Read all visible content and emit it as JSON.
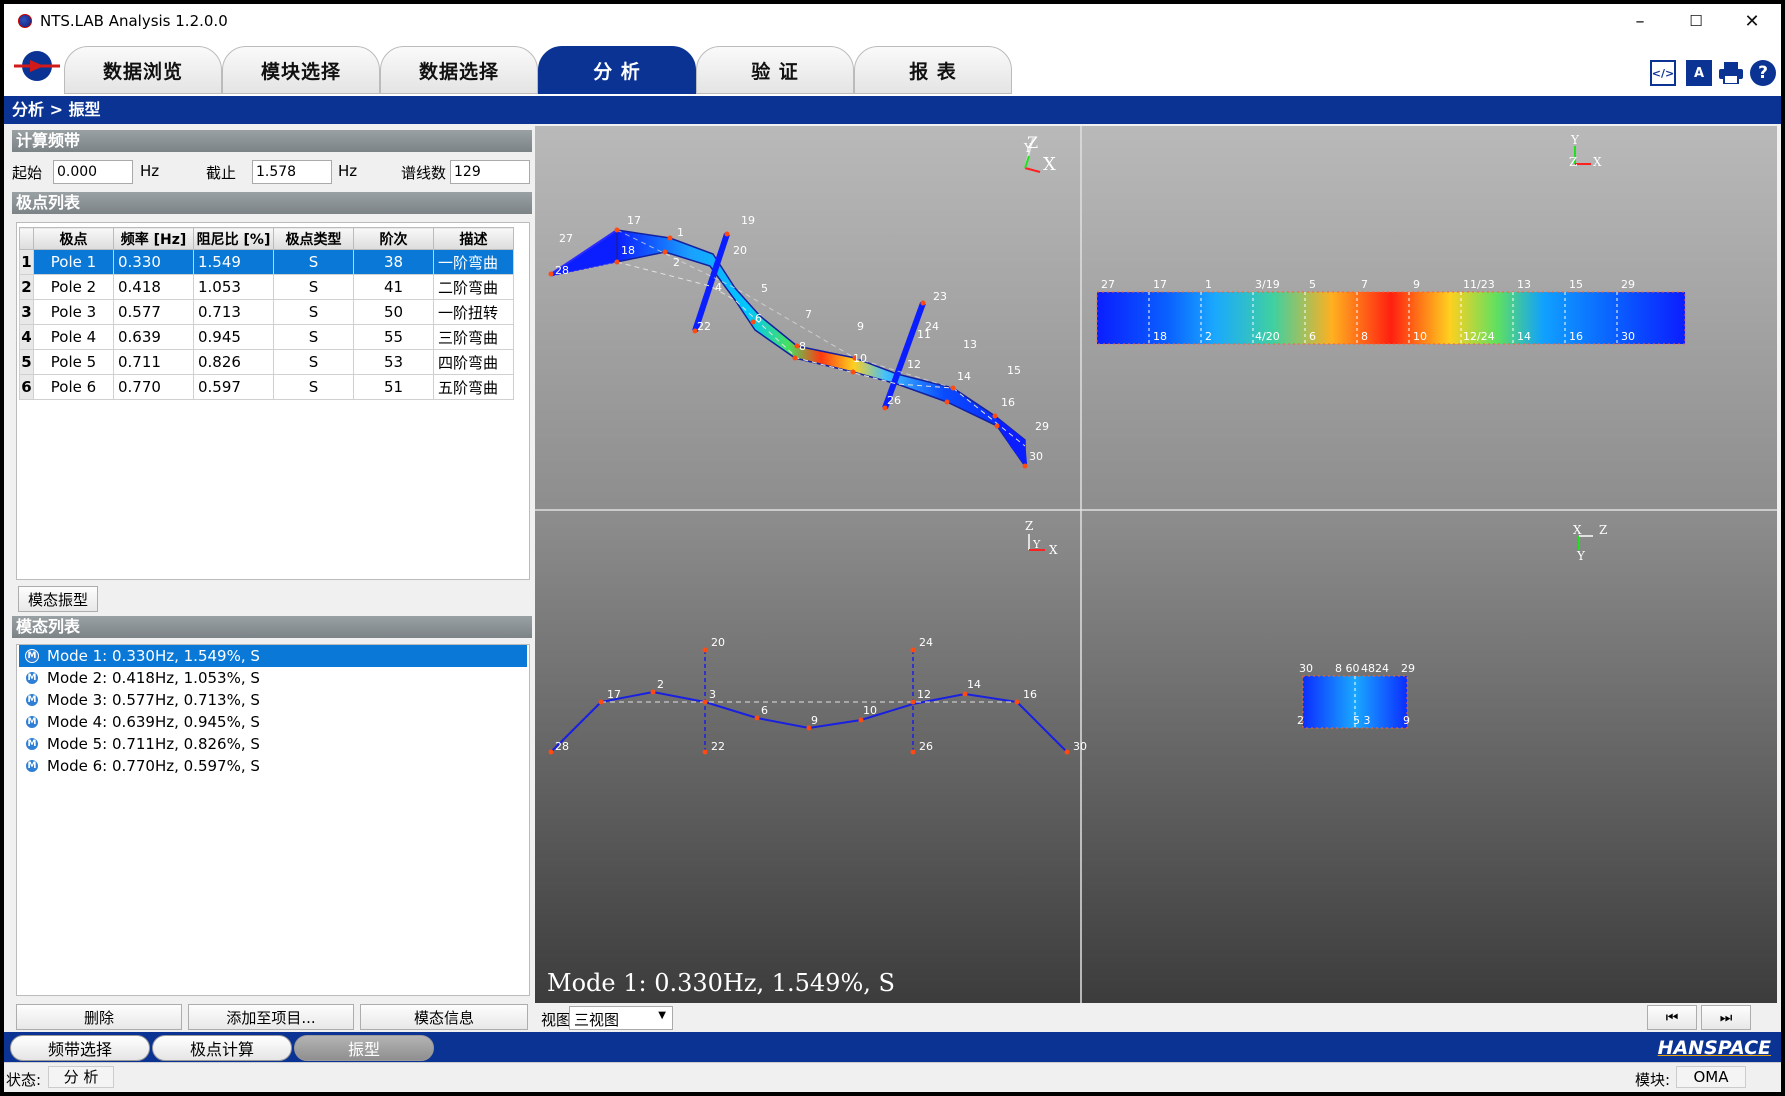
{
  "window": {
    "title": "NTS.LAB Analysis 1.2.0.0",
    "controls": {
      "minimize": "–",
      "maximize": "☐",
      "close": "✕"
    }
  },
  "main_tabs": [
    {
      "label": "数据浏览"
    },
    {
      "label": "模块选择"
    },
    {
      "label": "数据选择"
    },
    {
      "label": "分 析"
    },
    {
      "label": "验 证"
    },
    {
      "label": "报 表"
    }
  ],
  "tool_icons": [
    "code-window-icon",
    "translate-icon",
    "print-icon",
    "help-icon"
  ],
  "breadcrumb": "分析 > 振型",
  "band": {
    "header": "计算频带",
    "start_label": "起始",
    "start_value": "0.000",
    "start_unit": "Hz",
    "end_label": "截止",
    "end_value": "1.578",
    "end_unit": "Hz",
    "lines_label": "谱线数",
    "lines_value": "129"
  },
  "poles": {
    "header": "极点列表",
    "columns": [
      "极点",
      "频率 [Hz]",
      "阻尼比 [%]",
      "极点类型",
      "阶次",
      "描述"
    ],
    "rows": [
      {
        "idx": "1",
        "pole": "Pole 1",
        "freq": "0.330",
        "damp": "1.549",
        "type": "S",
        "order": "38",
        "desc": "一阶弯曲"
      },
      {
        "idx": "2",
        "pole": "Pole 2",
        "freq": "0.418",
        "damp": "1.053",
        "type": "S",
        "order": "41",
        "desc": "二阶弯曲"
      },
      {
        "idx": "3",
        "pole": "Pole 3",
        "freq": "0.577",
        "damp": "0.713",
        "type": "S",
        "order": "50",
        "desc": "一阶扭转"
      },
      {
        "idx": "4",
        "pole": "Pole 4",
        "freq": "0.639",
        "damp": "0.945",
        "type": "S",
        "order": "55",
        "desc": "三阶弯曲"
      },
      {
        "idx": "5",
        "pole": "Pole 5",
        "freq": "0.711",
        "damp": "0.826",
        "type": "S",
        "order": "53",
        "desc": "四阶弯曲"
      },
      {
        "idx": "6",
        "pole": "Pole 6",
        "freq": "0.770",
        "damp": "0.597",
        "type": "S",
        "order": "51",
        "desc": "五阶弯曲"
      }
    ]
  },
  "mode_shape_button": "模态振型",
  "modes": {
    "header": "模态列表",
    "badge": "M",
    "items": [
      "Mode 1: 0.330Hz, 1.549%, S",
      "Mode 2: 0.418Hz, 1.053%, S",
      "Mode 3: 0.577Hz, 0.713%, S",
      "Mode 4: 0.639Hz, 0.945%, S",
      "Mode 5: 0.711Hz, 0.826%, S",
      "Mode 6: 0.770Hz, 0.597%, S"
    ]
  },
  "actions": {
    "delete": "删除",
    "add_to_project": "添加至项目...",
    "mode_info": "模态信息"
  },
  "viewport": {
    "overlay": "Mode 1: 0.330Hz, 1.549%, S",
    "axes": {
      "iso": {
        "a": "Z",
        "b": "Y",
        "c": "X"
      },
      "top": {
        "a": "Y",
        "b": "Z",
        "c": "X"
      },
      "front": {
        "a": "Z",
        "b": "Y",
        "c": "X"
      },
      "side": {
        "a": "X",
        "b": "Z",
        "c": "Y"
      }
    },
    "labels_iso": [
      "27",
      "28",
      "17",
      "18",
      "1",
      "2",
      "19",
      "20",
      "4",
      "22",
      "5",
      "6",
      "7",
      "8",
      "9",
      "10",
      "23",
      "24",
      "11",
      "12",
      "26",
      "13",
      "14",
      "15",
      "16",
      "29",
      "30"
    ],
    "labels_top_upper": [
      "27",
      "17",
      "1",
      "3/19",
      "5",
      "7",
      "9",
      "11/23",
      "13",
      "15",
      "29"
    ],
    "labels_top_lower": [
      "18",
      "2",
      "4/20",
      "6",
      "8",
      "10",
      "12/24",
      "14",
      "16",
      "30"
    ],
    "labels_front_upper": [
      "20",
      "24"
    ],
    "labels_front_mid": [
      "17",
      "2",
      "3",
      "6",
      "9",
      "10",
      "12",
      "14",
      "16"
    ],
    "labels_front_lower": [
      "28",
      "22",
      "26",
      "30"
    ],
    "labels_side_upper": [
      "30",
      "8 60",
      "4824",
      "29"
    ],
    "labels_side_lower": [
      "2",
      "5 3",
      "9"
    ]
  },
  "view_select": {
    "label": "视图",
    "value": "三视图"
  },
  "nav_buttons": {
    "prev": "⏮",
    "next": "⏭"
  },
  "sub_tabs": [
    {
      "label": "频带选择"
    },
    {
      "label": "极点计算"
    },
    {
      "label": "振型"
    }
  ],
  "brand": "HANSPACE",
  "status": {
    "label": "状态:",
    "value": "分 析",
    "module_label": "模块:",
    "module_value": "OMA"
  }
}
